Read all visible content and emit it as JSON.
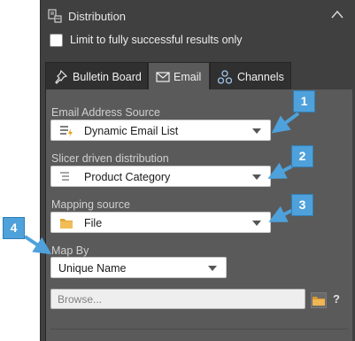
{
  "section": {
    "title": "Distribution"
  },
  "limit_checkbox": {
    "label": "Limit to fully successful results only",
    "checked": false
  },
  "tabs": [
    {
      "label": "Bulletin Board",
      "icon": "pin-icon",
      "active": false
    },
    {
      "label": "Email",
      "icon": "envelope-icon",
      "active": true
    },
    {
      "label": "Channels",
      "icon": "share-icon",
      "active": false
    }
  ],
  "email_address_source": {
    "label": "Email Address Source",
    "value": "Dynamic Email List",
    "icon": "dynamic-list-icon"
  },
  "slicer_distribution": {
    "label": "Slicer driven distribution",
    "value": "Product Category",
    "icon": "list-icon"
  },
  "mapping_source": {
    "label": "Mapping source",
    "value": "File",
    "icon": "folder-icon"
  },
  "map_by": {
    "label": "Map By",
    "value": "Unique Name"
  },
  "browse": {
    "placeholder": "Browse..."
  },
  "help": {
    "text": "?"
  },
  "callouts": [
    "1",
    "2",
    "3",
    "4"
  ],
  "colors": {
    "panel": "#404040",
    "content": "#5a5a5a",
    "callout": "#4ea1db"
  }
}
